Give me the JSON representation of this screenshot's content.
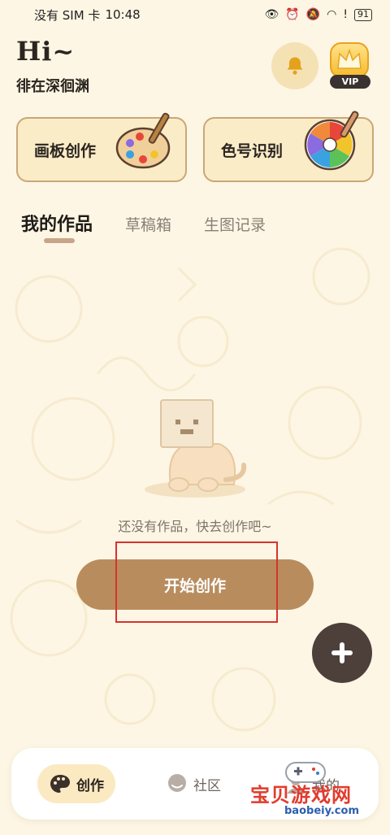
{
  "status_bar": {
    "carrier": "没有 SIM 卡",
    "time": "10:48",
    "battery": "91"
  },
  "header": {
    "greeting": "Hi~",
    "username": "徘在深徊渊",
    "vip_label": "VIP",
    "bell_icon": "bell-icon"
  },
  "tools": [
    {
      "label": "画板创作",
      "icon": "palette-brush-icon"
    },
    {
      "label": "色号识别",
      "icon": "color-wheel-dropper-icon"
    }
  ],
  "tabs": [
    {
      "label": "我的作品",
      "active": true
    },
    {
      "label": "草稿箱",
      "active": false
    },
    {
      "label": "生图记录",
      "active": false
    }
  ],
  "empty_state": {
    "message": "还没有作品，快去创作吧~",
    "button_label": "开始创作"
  },
  "fab_icon": "plus-icon",
  "bottom_nav": [
    {
      "label": "创作",
      "icon": "palette-icon",
      "active": true
    },
    {
      "label": "社区",
      "icon": "chat-bubble-icon",
      "active": false
    },
    {
      "label": "我的",
      "icon": "profile-icon",
      "active": false
    }
  ],
  "watermark": {
    "text": "宝贝游戏网",
    "url": "baobeiy.com"
  },
  "colors": {
    "background": "#fdf6e4",
    "accent_button": "#b98c5e",
    "fab": "#4d403a",
    "highlight": "#d8322f"
  }
}
